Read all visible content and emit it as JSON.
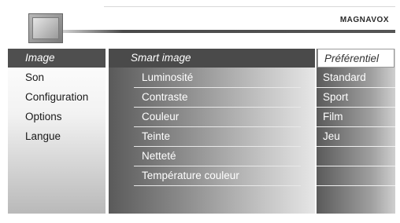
{
  "header": {
    "brand": "MAGNAVOX",
    "tv_icon": "tv-icon"
  },
  "main_menu": {
    "items": [
      {
        "label": "Image",
        "selected": true
      },
      {
        "label": "Son"
      },
      {
        "label": "Configuration"
      },
      {
        "label": "Options"
      },
      {
        "label": "Langue"
      }
    ]
  },
  "image_menu": {
    "title": "Smart image",
    "items": [
      {
        "label": "Luminosité"
      },
      {
        "label": "Contraste"
      },
      {
        "label": "Couleur"
      },
      {
        "label": "Teinte"
      },
      {
        "label": "Netteté"
      },
      {
        "label": "Température couleur"
      }
    ]
  },
  "smart_image_options": {
    "items": [
      {
        "label": "Préférentiel",
        "selected": true
      },
      {
        "label": "Standard"
      },
      {
        "label": "Sport"
      },
      {
        "label": "Film"
      },
      {
        "label": "Jeu"
      }
    ]
  }
}
